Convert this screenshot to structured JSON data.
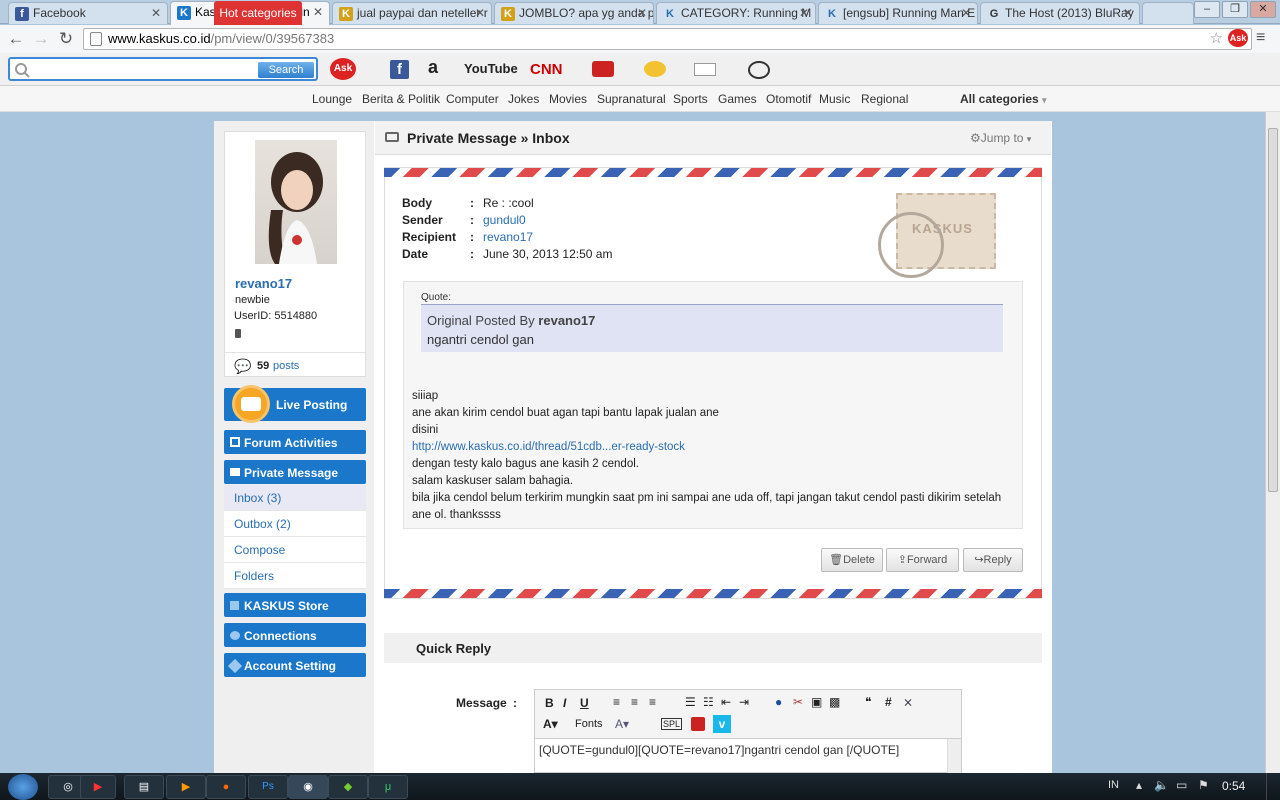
{
  "browser": {
    "tabs": [
      {
        "title": "Facebook",
        "favicon": "f",
        "color": "#3b5998"
      },
      {
        "title": "Kaskus - Home Login",
        "favicon": "K",
        "color": "#1a77c9"
      },
      {
        "title": "jual paypai dan neteller r",
        "favicon": "K",
        "color": "#d4a017"
      },
      {
        "title": "JOMBLO? apa yg anda p",
        "favicon": "K",
        "color": "#d4a017"
      },
      {
        "title": "CATEGORY: Running M",
        "favicon": "K",
        "color": "#2a6db0"
      },
      {
        "title": "[engsub] Running Man E",
        "favicon": "K",
        "color": "#2a6db0"
      },
      {
        "title": "The Host (2013) BluRay",
        "favicon": "G",
        "color": "#333333"
      }
    ],
    "url_host": "www.kaskus.co.id",
    "url_path": "/pm/view/0/39567383"
  },
  "toolbar": {
    "search_label": "Search",
    "ask": "Ask",
    "facebook": "f",
    "amazon": "a",
    "youtube": "YouTube",
    "cnn": "CNN"
  },
  "categories": {
    "hot": "Hot categories",
    "items": [
      "Lounge",
      "Berita & Politik",
      "Computer",
      "Jokes",
      "Movies",
      "Supranatural",
      "Sports",
      "Games",
      "Otomotif",
      "Music",
      "Regional"
    ],
    "all": "All categories"
  },
  "profile": {
    "username": "revano17",
    "rank": "newbie",
    "userid": "UserID: 5514880",
    "posts_count": "59",
    "posts_label": "posts"
  },
  "sidebar": {
    "live_posting": "Live Posting",
    "forum_activities": "Forum Activities",
    "private_message": "Private Message",
    "pm_items": [
      "Inbox (3)",
      "Outbox (2)",
      "Compose",
      "Folders"
    ],
    "store": "KASKUS Store",
    "connections": "Connections",
    "account": "Account Setting"
  },
  "main": {
    "title": "Private Message » Inbox",
    "jump": "Jump to",
    "stamp_text": "KASKUS",
    "body_label": "Body",
    "body_value": "Re : :cool",
    "sender_label": "Sender",
    "sender_value": "gundul0",
    "recipient_label": "Recipient",
    "recipient_value": "revano17",
    "date_label": "Date",
    "date_value": "June 30, 2013 12:50 am",
    "colon": ":",
    "quote_label": "Quote:",
    "quote_posted_by": "Original Posted By",
    "quote_author": "revano17",
    "quote_text": "ngantri cendol gan",
    "lines": [
      "siiiap",
      "ane akan kirim cendol buat agan tapi bantu lapak jualan ane",
      "disini",
      "http://www.kaskus.co.id/thread/51cdb...er-ready-stock",
      "dengan testy kalo bagus ane kasih 2 cendol.",
      "salam kaskuser salam bahagia.",
      "bila jika cendol belum terkirim mungkin saat pm ini sampai ane uda off, tapi jangan takut cendol pasti dikirim setelah",
      "ane ol. thankssss"
    ],
    "delete": "Delete",
    "forward": "Forward",
    "reply": "Reply",
    "quick_reply": "Quick Reply",
    "message_label": "Message",
    "fonts": "Fonts",
    "editor_text": "[QUOTE=gundul0][QUOTE=revano17]ngantri cendol gan [/QUOTE]"
  },
  "taskbar": {
    "lang": "IN",
    "time": "0:54"
  }
}
